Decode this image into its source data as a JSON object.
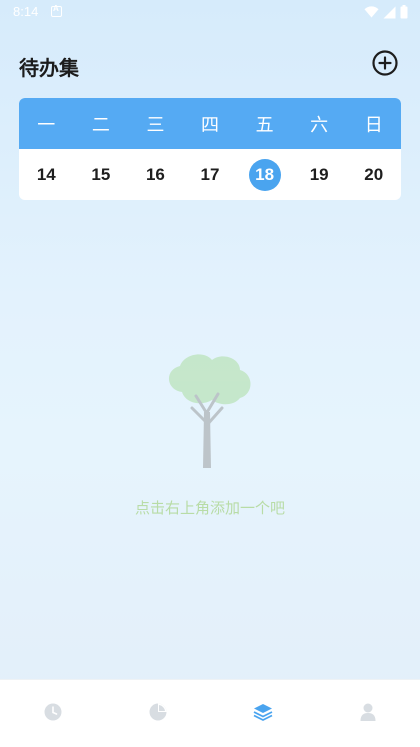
{
  "status_bar": {
    "time": "8:14",
    "icons": [
      "android-notification-icon",
      "wifi-icon",
      "signal-icon",
      "battery-icon"
    ]
  },
  "header": {
    "title": "待办集",
    "add_icon": "add-circle-icon"
  },
  "calendar": {
    "weekdays": [
      "一",
      "二",
      "三",
      "四",
      "五",
      "六",
      "日"
    ],
    "dates": [
      "14",
      "15",
      "16",
      "17",
      "18",
      "19",
      "20"
    ],
    "selected_date": "18",
    "header_color": "#55aaf3",
    "selected_color": "#4aa4ef"
  },
  "empty_state": {
    "illustration": "tree-icon",
    "text": "点击右上角添加一个吧"
  },
  "bottom_nav": {
    "items": [
      {
        "icon": "clock-icon",
        "active": false
      },
      {
        "icon": "pie-chart-icon",
        "active": false
      },
      {
        "icon": "layers-icon",
        "active": true
      },
      {
        "icon": "person-icon",
        "active": false
      }
    ],
    "active_color": "#4aa4ef",
    "inactive_color": "#d8dde2"
  }
}
